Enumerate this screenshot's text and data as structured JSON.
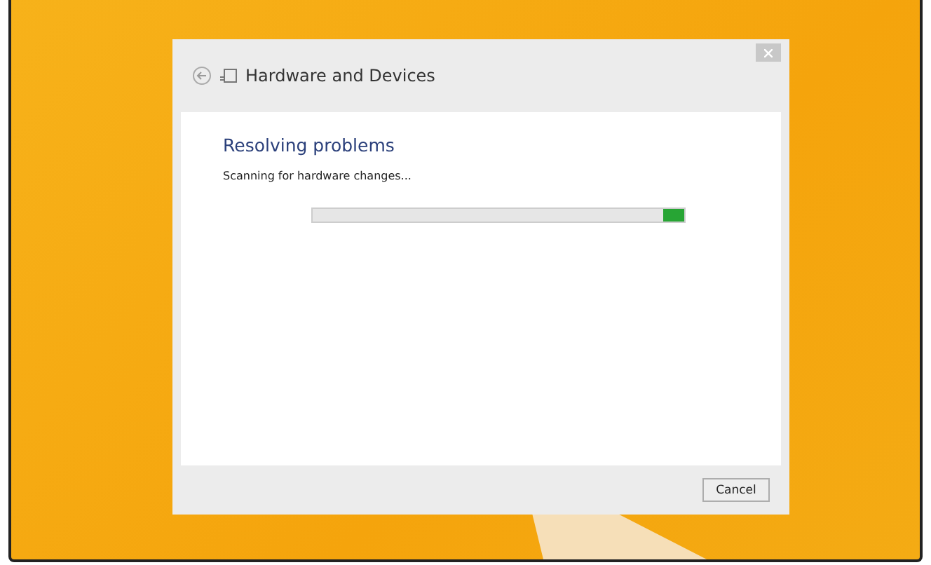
{
  "window": {
    "title": "Hardware and Devices"
  },
  "heading": "Resolving problems",
  "status": "Scanning for hardware changes...",
  "progress": {
    "level": 1
  },
  "buttons": [
    {
      "label": "Cancel"
    }
  ]
}
